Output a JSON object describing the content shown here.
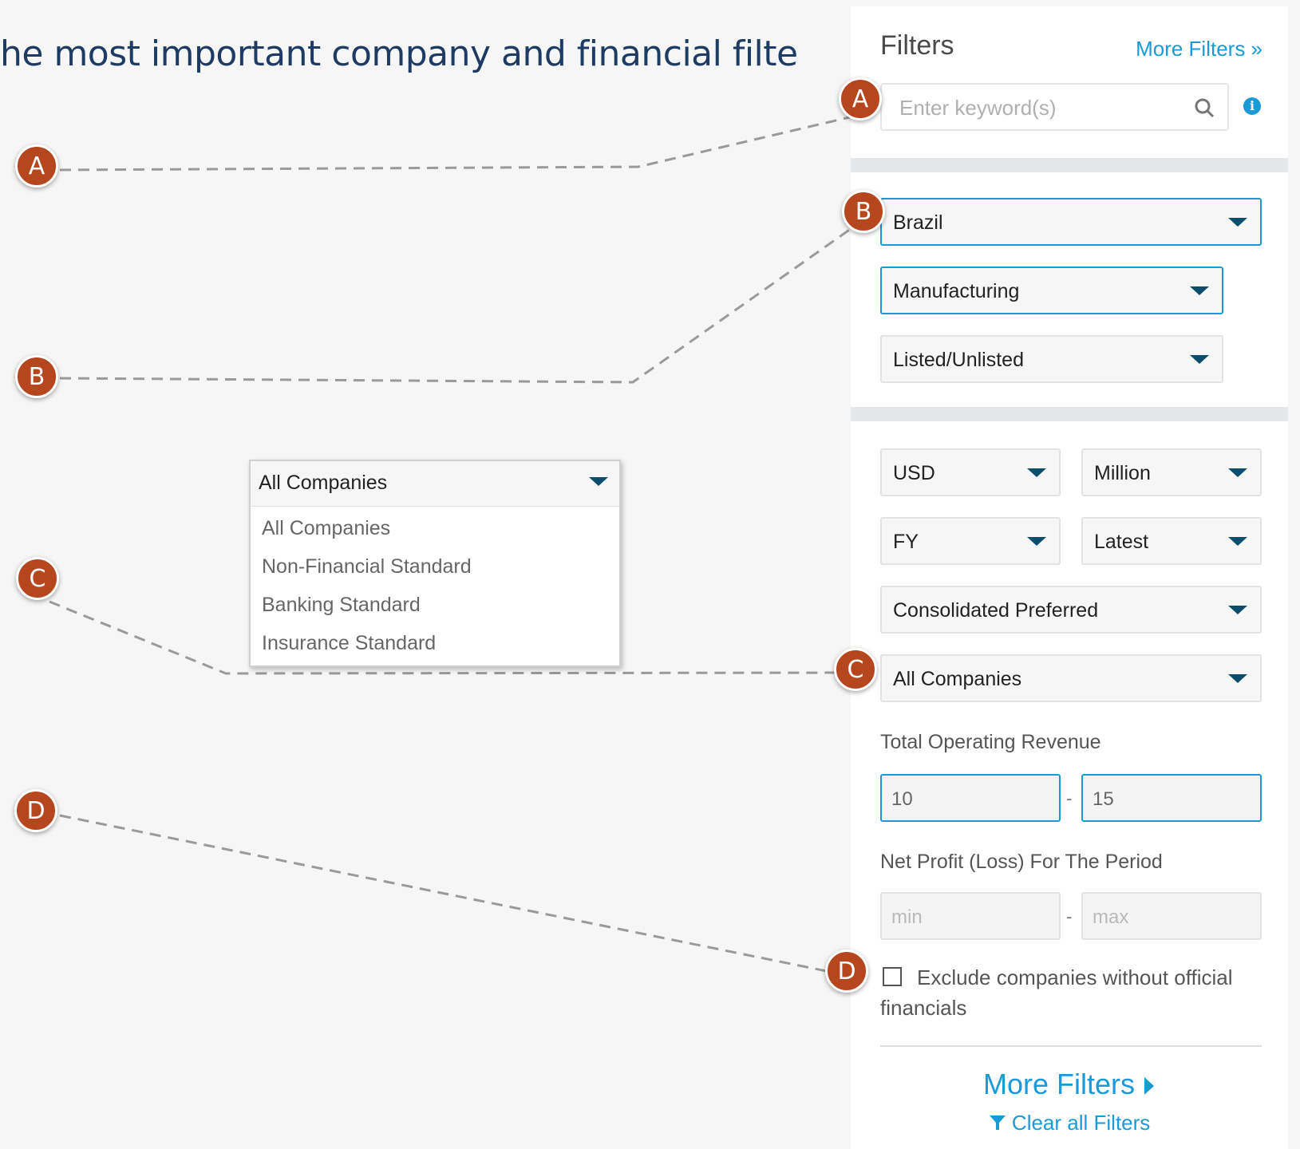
{
  "headline": "he most important company and financial filters",
  "markers": {
    "a": "A",
    "b": "B",
    "c": "C",
    "d": "D"
  },
  "panel": {
    "title": "Filters",
    "more_filters_top": "More Filters »",
    "search_placeholder": "Enter keyword(s)",
    "info_icon": "i",
    "country": "Brazil",
    "industry": "Manufacturing",
    "listing": "Listed/Unlisted",
    "currency": "USD",
    "units": "Million",
    "period_type": "FY",
    "period": "Latest",
    "accounts": "Consolidated Preferred",
    "company_type": "All Companies",
    "revenue": {
      "label": "Total Operating Revenue",
      "min": "10",
      "max": "15",
      "separator": "-"
    },
    "net_profit": {
      "label": "Net Profit (Loss) For The Period",
      "min_placeholder": "min",
      "max_placeholder": "max",
      "separator": "-"
    },
    "exclude_label": "Exclude companies without official financials",
    "more_filters_bottom": "More Filters",
    "clear_all": "Clear all Filters"
  },
  "popup": {
    "selected": "All Companies",
    "options": [
      "All Companies",
      "Non-Financial Standard",
      "Banking Standard",
      "Insurance Standard"
    ]
  },
  "colors": {
    "accent": "#1a9ad6",
    "marker": "#b5461d",
    "headline": "#1f3b63",
    "caret": "#0b4d6b"
  }
}
